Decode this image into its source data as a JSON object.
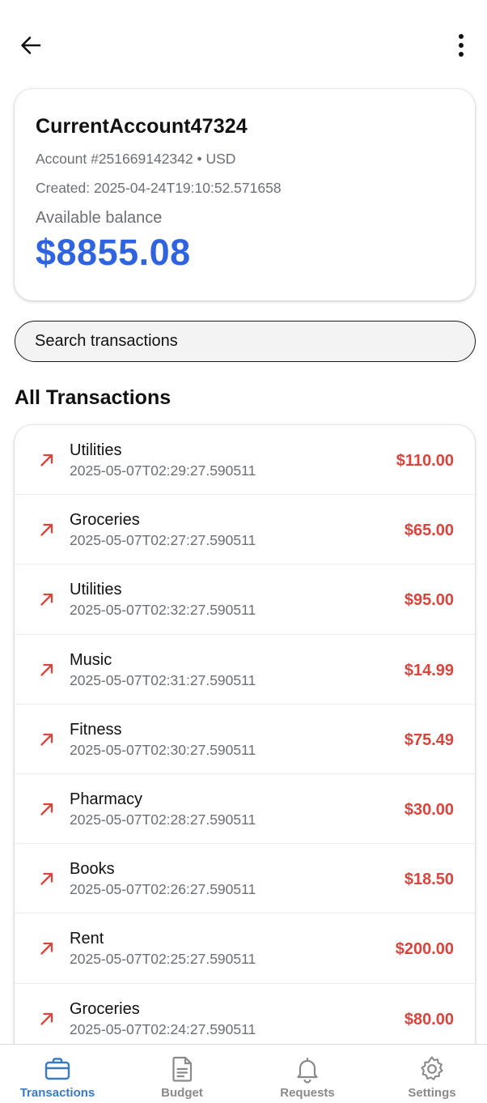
{
  "account": {
    "name": "CurrentAccount47324",
    "number_line": "Account #251669142342 • USD",
    "created_line": "Created: 2025-04-24T19:10:52.571658",
    "available_label": "Available balance",
    "balance": "$8855.08"
  },
  "search": {
    "placeholder": "Search transactions"
  },
  "section_title": "All Transactions",
  "transactions": [
    {
      "title": "Utilities",
      "date": "2025-05-07T02:29:27.590511",
      "amount": "$110.00",
      "icon": "outgoing-arrow-icon"
    },
    {
      "title": "Groceries",
      "date": "2025-05-07T02:27:27.590511",
      "amount": "$65.00",
      "icon": "outgoing-arrow-icon"
    },
    {
      "title": "Utilities",
      "date": "2025-05-07T02:32:27.590511",
      "amount": "$95.00",
      "icon": "outgoing-arrow-icon"
    },
    {
      "title": "Music",
      "date": "2025-05-07T02:31:27.590511",
      "amount": "$14.99",
      "icon": "outgoing-arrow-icon"
    },
    {
      "title": "Fitness",
      "date": "2025-05-07T02:30:27.590511",
      "amount": "$75.49",
      "icon": "outgoing-arrow-icon"
    },
    {
      "title": "Pharmacy",
      "date": "2025-05-07T02:28:27.590511",
      "amount": "$30.00",
      "icon": "outgoing-arrow-icon"
    },
    {
      "title": "Books",
      "date": "2025-05-07T02:26:27.590511",
      "amount": "$18.50",
      "icon": "outgoing-arrow-icon"
    },
    {
      "title": "Rent",
      "date": "2025-05-07T02:25:27.590511",
      "amount": "$200.00",
      "icon": "outgoing-arrow-icon"
    },
    {
      "title": "Groceries",
      "date": "2025-05-07T02:24:27.590511",
      "amount": "$80.00",
      "icon": "outgoing-arrow-icon"
    }
  ],
  "nav": [
    {
      "label": "Transactions",
      "icon": "briefcase-icon",
      "active": true
    },
    {
      "label": "Budget",
      "icon": "document-icon",
      "active": false
    },
    {
      "label": "Requests",
      "icon": "bell-icon",
      "active": false
    },
    {
      "label": "Settings",
      "icon": "gear-icon",
      "active": false
    }
  ],
  "colors": {
    "balance": "#2f63e0",
    "debit": "#d9453d",
    "nav_active": "#3a7bbf",
    "nav_inactive": "#8a8a8a"
  }
}
